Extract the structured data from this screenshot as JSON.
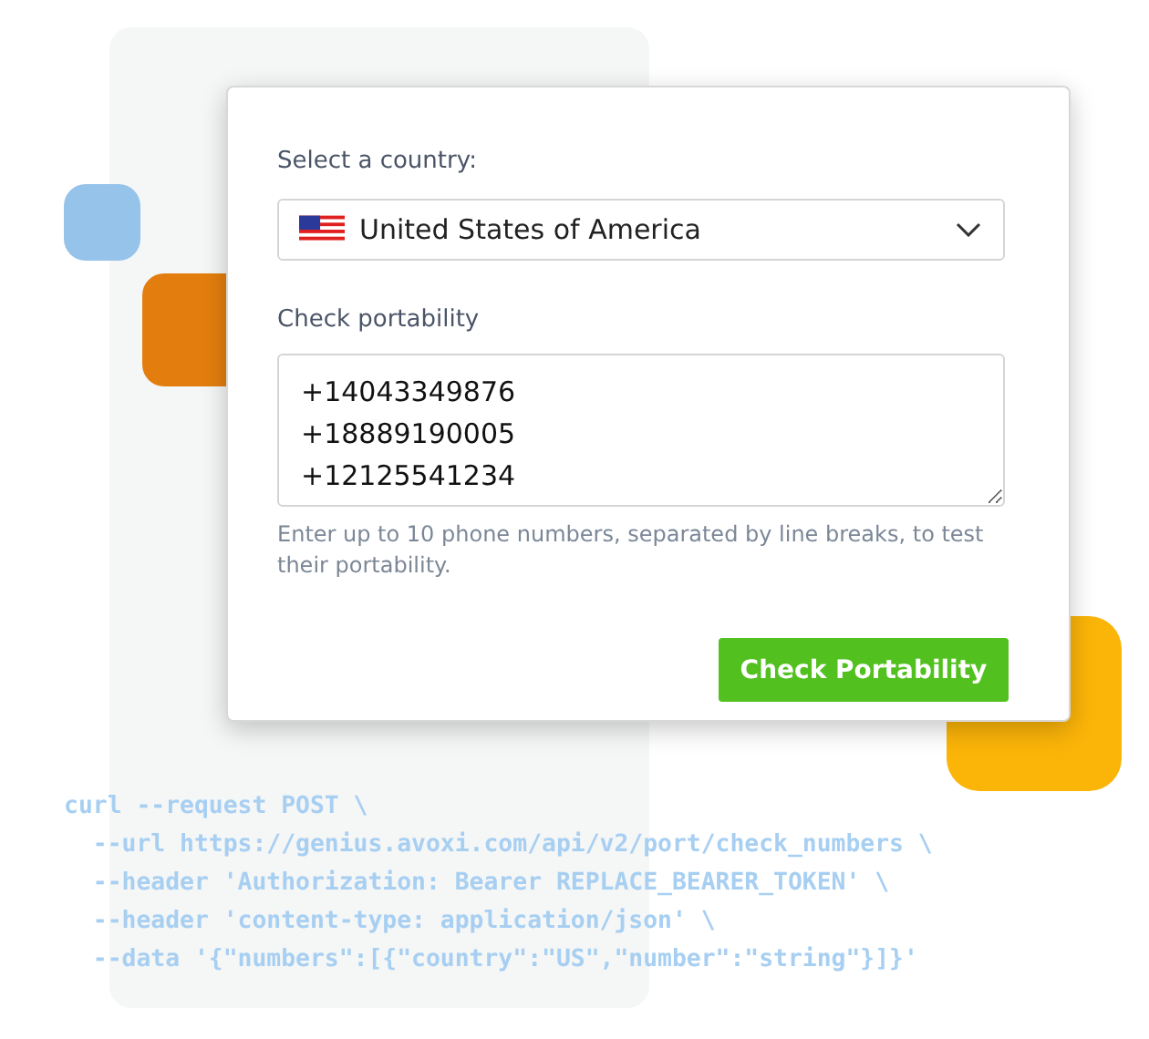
{
  "form": {
    "country_label": "Select a country:",
    "country": {
      "value": "United States of America"
    },
    "numbers_label": "Check portability",
    "numbers": {
      "value": "+14043349876\n+18889190005\n+12125541234"
    },
    "hint": "Enter up to 10 phone numbers, separated by line breaks, to test their portability.",
    "button": "Check Portability"
  },
  "code_lines": [
    "curl --request POST \\",
    "  --url https://genius.avoxi.com/api/v2/port/check_numbers \\",
    "  --header 'Authorization: Bearer REPLACE_BEARER_TOKEN' \\",
    "  --header 'content-type: application/json' \\",
    "  --data '{\"numbers\":[{\"country\":\"US\",\"number\":\"string\"}]}'"
  ]
}
